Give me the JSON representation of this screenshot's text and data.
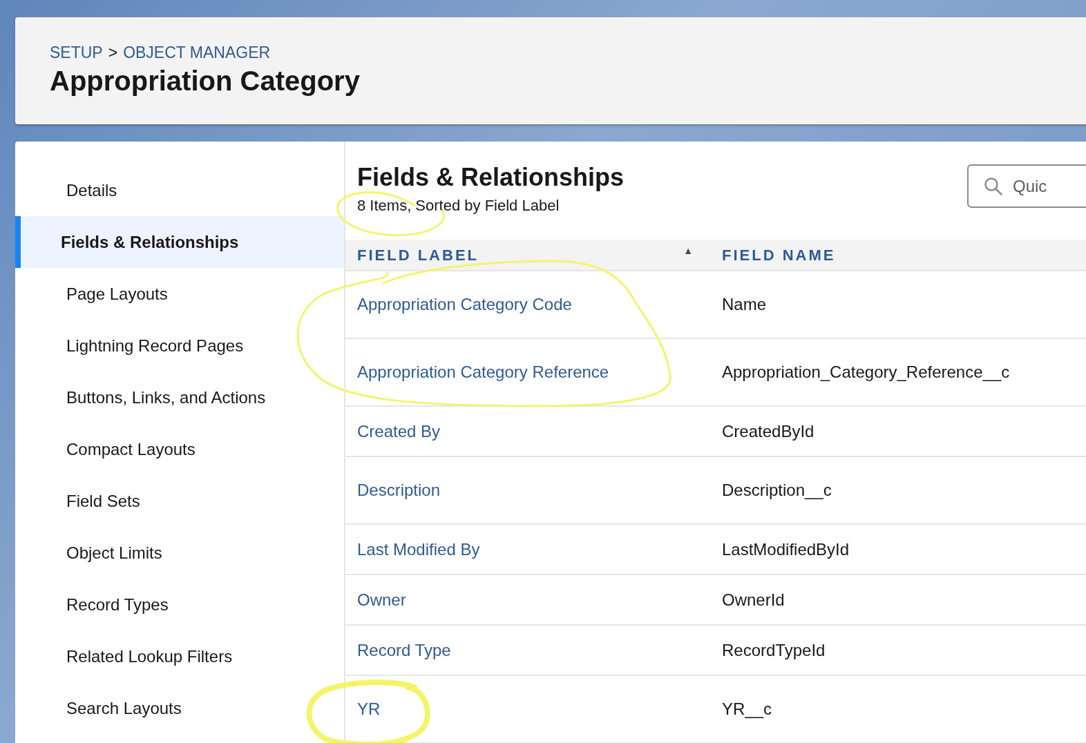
{
  "breadcrumb": [
    {
      "label": "SETUP"
    },
    {
      "label": ">"
    },
    {
      "label": "OBJECT MANAGER"
    }
  ],
  "title": "Appropriation Category",
  "sidebar": {
    "items": [
      {
        "label": "Details",
        "selected": false
      },
      {
        "label": "Fields & Relationships",
        "selected": true
      },
      {
        "label": "Page Layouts",
        "selected": false
      },
      {
        "label": "Lightning Record Pages",
        "selected": false
      },
      {
        "label": "Buttons, Links, and Actions",
        "selected": false
      },
      {
        "label": "Compact Layouts",
        "selected": false
      },
      {
        "label": "Field Sets",
        "selected": false
      },
      {
        "label": "Object Limits",
        "selected": false
      },
      {
        "label": "Record Types",
        "selected": false
      },
      {
        "label": "Related Lookup Filters",
        "selected": false
      },
      {
        "label": "Search Layouts",
        "selected": false
      }
    ]
  },
  "panel": {
    "title": "Fields & Relationships",
    "subtitle": "8 Items, Sorted by Field Label",
    "search": {
      "placeholder": "Quic"
    }
  },
  "table": {
    "columns": [
      {
        "label": "FIELD LABEL",
        "sort": "▲"
      },
      {
        "label": "FIELD NAME"
      }
    ],
    "rows": [
      {
        "label": "Appropriation Category Code",
        "name": "Name"
      },
      {
        "label": "Appropriation Category Reference",
        "name": "Appropriation_Category_Reference__c"
      },
      {
        "label": "Created By",
        "name": "CreatedById"
      },
      {
        "label": "Description",
        "name": "Description__c"
      },
      {
        "label": "Last Modified By",
        "name": "LastModifiedById"
      },
      {
        "label": "Owner",
        "name": "OwnerId"
      },
      {
        "label": "Record Type",
        "name": "RecordTypeId"
      },
      {
        "label": "YR",
        "name": "YR__c"
      }
    ]
  },
  "annotations": [
    {
      "kind": "loop"
    },
    {
      "kind": "loop"
    },
    {
      "kind": "loop"
    }
  ]
}
